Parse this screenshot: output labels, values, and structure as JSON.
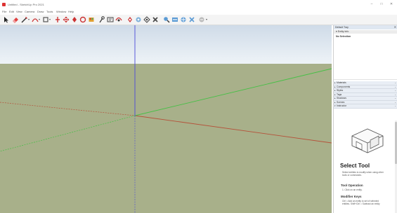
{
  "window": {
    "title": "Untitled - SketchUp Pro 2021",
    "minimize": "–",
    "maximize": "□",
    "close": "✕"
  },
  "menu": [
    "File",
    "Edit",
    "View",
    "Camera",
    "Draw",
    "Tools",
    "Window",
    "Help"
  ],
  "toolbar": {
    "tools": [
      "select-icon",
      "eraser-icon",
      "line-icon",
      "arc-icon",
      "rectangle-icon",
      "push-pull-icon",
      "move-icon",
      "rotate-icon",
      "offset-icon",
      "paint-bucket-icon",
      "tape-measure-icon",
      "text-icon",
      "orbit-icon",
      "pan-icon",
      "zoom-icon",
      "zoom-extents-icon",
      "previous-view-icon",
      "walk-icon",
      "section-plane-icon",
      "warehouse-icon",
      "extension-icon"
    ]
  },
  "tray": {
    "title": "Default Tray",
    "entity_info": "Entity Info",
    "no_selection": "No Selection",
    "panels": [
      "Materials",
      "Components",
      "Styles",
      "Tags",
      "Shadows",
      "Scenes",
      "Instructor"
    ]
  },
  "instructor": {
    "title": "Select Tool",
    "description": "Select entities to modify when using other tools or commands.",
    "operation_heading": "Tool Operation",
    "operation_step": "1. Click on an entity.",
    "modifier_heading": "Modifier Keys",
    "modifier_text": "Ctrl = Add an entity to set of selected entities. Shift+Ctrl = Subtract an entity"
  },
  "colors": {
    "sky_top": "#cfdbe8",
    "sky_bottom": "#eef3f7",
    "ground": "#a8b08a",
    "axis_red": "#b5523a",
    "axis_green": "#46c046",
    "axis_blue": "#4a4ad8"
  }
}
